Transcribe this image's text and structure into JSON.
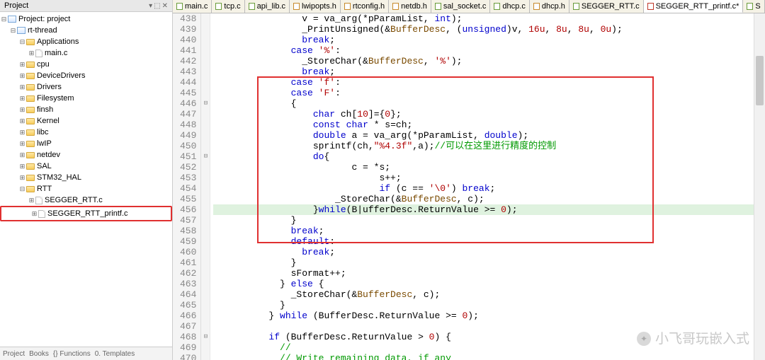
{
  "sidebar": {
    "title": "Project",
    "root": "Project: project",
    "rt": "rt-thread",
    "apps": "Applications",
    "mainc": "main.c",
    "folders": [
      "cpu",
      "DeviceDrivers",
      "Drivers",
      "Filesystem",
      "finsh",
      "Kernel",
      "libc",
      "lwIP",
      "netdev",
      "SAL",
      "STM32_HAL"
    ],
    "rtt": "RTT",
    "seg1": "SEGGER_RTT.c",
    "seg2": "SEGGER_RTT_printf.c",
    "bottom": [
      "Project",
      "Books",
      "{} Functions",
      "0. Templates"
    ]
  },
  "tabs": [
    {
      "label": "main.c",
      "t": "c"
    },
    {
      "label": "tcp.c",
      "t": "c"
    },
    {
      "label": "api_lib.c",
      "t": "c"
    },
    {
      "label": "lwipopts.h",
      "t": "h"
    },
    {
      "label": "rtconfig.h",
      "t": "h"
    },
    {
      "label": "netdb.h",
      "t": "h"
    },
    {
      "label": "sal_socket.c",
      "t": "c"
    },
    {
      "label": "dhcp.c",
      "t": "c"
    },
    {
      "label": "dhcp.h",
      "t": "h"
    },
    {
      "label": "SEGGER_RTT.c",
      "t": "c"
    },
    {
      "label": "SEGGER_RTT_printf.c*",
      "t": "last",
      "active": true
    },
    {
      "label": "S",
      "t": "c"
    }
  ],
  "lines": [
    {
      "n": 438,
      "h": "                v = va_arg(*pParamList, <span class='t'>int</span>);"
    },
    {
      "n": 439,
      "h": "                _PrintUnsigned(&amp;<span class='m'>BufferDesc</span>, (<span class='t'>unsigned</span>)v, <span class='n'>16u</span>, <span class='n'>8u</span>, <span class='n'>8u</span>, <span class='n'>0u</span>);"
    },
    {
      "n": 440,
      "h": "                <span class='k'>break</span>;"
    },
    {
      "n": 441,
      "h": "              <span class='k'>case</span> <span class='s'>'%'</span>:"
    },
    {
      "n": 442,
      "h": "                _StoreChar(&amp;<span class='m'>BufferDesc</span>, <span class='s'>'%'</span>);"
    },
    {
      "n": 443,
      "h": "                <span class='k'>break</span>;"
    },
    {
      "n": 444,
      "h": "              <span class='k'>case</span> <span class='s'>'f'</span>:"
    },
    {
      "n": 445,
      "h": "              <span class='k'>case</span> <span class='s'>'F'</span>:"
    },
    {
      "n": 446,
      "h": "              {",
      "fold": "⊟"
    },
    {
      "n": 447,
      "h": "                  <span class='t'>char</span> ch[<span class='n'>10</span>]={<span class='n'>0</span>};"
    },
    {
      "n": 448,
      "h": "                  <span class='t'>const</span> <span class='t'>char</span> * s=ch;"
    },
    {
      "n": 449,
      "h": "                  <span class='t'>double</span> a = va_arg(*pParamList, <span class='t'>double</span>);"
    },
    {
      "n": 450,
      "h": "                  sprintf(ch,<span class='s'>\"%4.3f\"</span>,a);<span class='c'>//可以在这里进行精度的控制</span>"
    },
    {
      "n": 451,
      "h": "                  <span class='k'>do</span>{",
      "fold": "⊟"
    },
    {
      "n": 452,
      "h": "                         c = *s;"
    },
    {
      "n": 453,
      "h": "                              s++;"
    },
    {
      "n": 454,
      "h": "                              <span class='k'>if</span> (c == <span class='s'>'\\0'</span>) <span class='k'>break</span>;"
    },
    {
      "n": 455,
      "h": "                      _StoreChar(&amp;<span class='m'>BufferDesc</span>, c);"
    },
    {
      "n": 456,
      "h": "                  }<span class='k'>while</span>(B|ufferDesc.ReturnValue &gt;= <span class='n'>0</span>);",
      "cur": true
    },
    {
      "n": 457,
      "h": "              }"
    },
    {
      "n": 458,
      "h": "              <span class='k'>break</span>;"
    },
    {
      "n": 459,
      "h": "              <span class='k'>default</span>:"
    },
    {
      "n": 460,
      "h": "                <span class='k'>break</span>;"
    },
    {
      "n": 461,
      "h": "              }"
    },
    {
      "n": 462,
      "h": "              sFormat++;"
    },
    {
      "n": 463,
      "h": "            } <span class='k'>else</span> {"
    },
    {
      "n": 464,
      "h": "              _StoreChar(&amp;<span class='m'>BufferDesc</span>, c);"
    },
    {
      "n": 465,
      "h": "            }"
    },
    {
      "n": 466,
      "h": "          } <span class='k'>while</span> (BufferDesc.ReturnValue &gt;= <span class='n'>0</span>);"
    },
    {
      "n": 467,
      "h": ""
    },
    {
      "n": 468,
      "h": "          <span class='k'>if</span> (BufferDesc.ReturnValue &gt; <span class='n'>0</span>) {",
      "fold": "⊟"
    },
    {
      "n": 469,
      "h": "            <span class='c'>//</span>"
    },
    {
      "n": 470,
      "h": "            <span class='c'>// Write remaining data, if any</span>"
    }
  ],
  "watermark": "小飞哥玩嵌入式"
}
